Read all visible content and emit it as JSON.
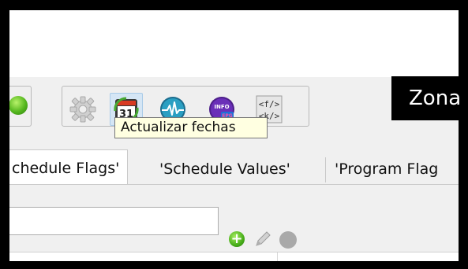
{
  "toolbar": {
    "tooltip": "Actualizar fechas",
    "calendar_day": "31",
    "info_badge": "INFO",
    "epg_badge": "EPG",
    "code_top": "<f/>",
    "code_bottom": "<k/>",
    "zona_label": "Zona"
  },
  "tabs": [
    {
      "label": "chedule Flags'",
      "active": true
    },
    {
      "label": "'Schedule Values'",
      "active": false
    },
    {
      "label": "'Program Flag",
      "active": false
    }
  ],
  "filter": {
    "value": "",
    "placeholder": ""
  },
  "icons": {
    "green_button": "green-circle-icon",
    "settings": "gear-icon",
    "update_dates": "calendar-refresh-icon",
    "signal": "signal-wave-icon",
    "info_epg": "info-epg-icon",
    "code": "code-xml-icon",
    "add": "add-green-icon",
    "edit": "pencil-icon",
    "delete": "delete-grey-icon"
  },
  "colors": {
    "accent_green": "#55b71e",
    "tooltip_bg": "#ffffe1",
    "hover_blue": "#d5e6f5",
    "zona_bg": "#000000"
  }
}
